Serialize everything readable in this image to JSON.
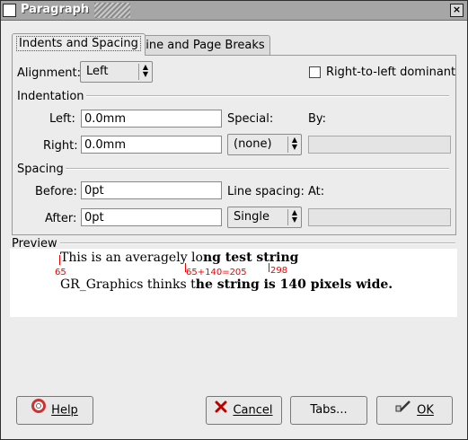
{
  "window": {
    "title": "Paragraph",
    "close_glyph": "×"
  },
  "tabs": [
    {
      "label": "Indents and Spacing",
      "active": true
    },
    {
      "label": "Line and Page Breaks",
      "active": false
    }
  ],
  "alignment": {
    "label": "Alignment:",
    "value": "Left",
    "arrows": "▲▼"
  },
  "rtl": {
    "label": "Right-to-left dominant",
    "checked": false
  },
  "indentation": {
    "section_label": "Indentation",
    "left_label": "Left:",
    "left_value": "0.0mm",
    "right_label": "Right:",
    "right_value": "0.0mm",
    "special_label": "Special:",
    "special_value": "(none)",
    "by_label": "By:",
    "by_value": ""
  },
  "spacing": {
    "section_label": "Spacing",
    "before_label": "Before:",
    "before_value": "0pt",
    "after_label": "After:",
    "after_value": "0pt",
    "line_spacing_label": "Line spacing:",
    "line_spacing_value": "Single",
    "at_label": "At:",
    "at_value": ""
  },
  "preview": {
    "section_label": "Preview",
    "line1_normal": "This is an averagely lo",
    "line1_bold": "ng test string",
    "line2_normal": "GR_Graphics thinks t",
    "line2_bold": "he string is 140 pixels wide.",
    "mark_start": "65",
    "mark_mid": "65+140=205",
    "mark_end": "298"
  },
  "buttons": {
    "help": {
      "label": "Help",
      "icon": "lifebuoy-icon"
    },
    "cancel": {
      "label": "Cancel",
      "icon": "x-icon"
    },
    "tabs": {
      "label": "Tabs..."
    },
    "ok": {
      "label": "OK",
      "icon": "check-hand-icon"
    }
  }
}
